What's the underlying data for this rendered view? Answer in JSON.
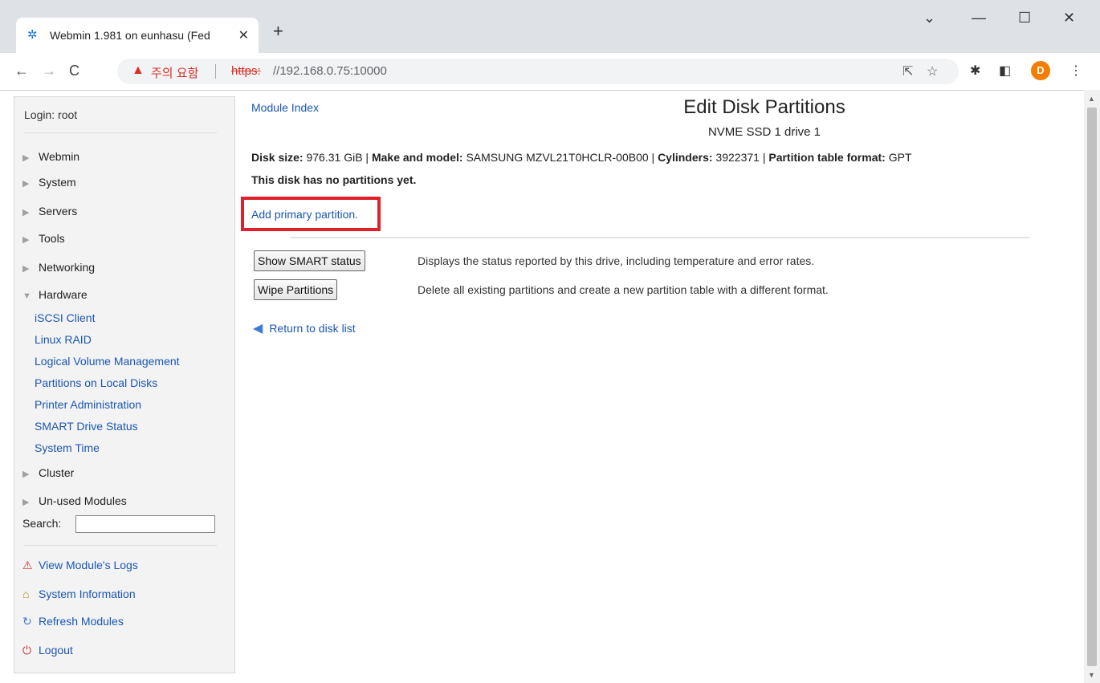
{
  "browser": {
    "tab_title": "Webmin 1.981 on eunhasu (Fed",
    "tab_icon": "webmin-logo-icon",
    "new_tab": "+",
    "warning_text": "주의 요함",
    "url_scheme": "https:",
    "url_rest": "//192.168.0.75:10000",
    "profile_initial": "D"
  },
  "sidebar": {
    "login": "Login: root",
    "categories": [
      {
        "label": "Webmin",
        "expanded": false
      },
      {
        "label": "System",
        "expanded": false
      },
      {
        "label": "Servers",
        "expanded": false
      },
      {
        "label": "Tools",
        "expanded": false
      },
      {
        "label": "Networking",
        "expanded": false
      },
      {
        "label": "Hardware",
        "expanded": true
      }
    ],
    "hardware_items": [
      "iSCSI Client",
      "Linux RAID",
      "Logical Volume Management",
      "Partitions on Local Disks",
      "Printer Administration",
      "SMART Drive Status",
      "System Time"
    ],
    "categories_after": [
      {
        "label": "Cluster"
      },
      {
        "label": "Un-used Modules"
      }
    ],
    "search_label": "Search:",
    "search_value": "",
    "footer_links": [
      {
        "label": "View Module's Logs",
        "icon": "warning-icon"
      },
      {
        "label": "System Information",
        "icon": "home-icon"
      },
      {
        "label": "Refresh Modules",
        "icon": "refresh-icon"
      },
      {
        "label": "Logout",
        "icon": "power-icon"
      }
    ]
  },
  "main": {
    "module_index": "Module Index",
    "title": "Edit Disk Partitions",
    "subtitle": "NVME SSD 1 drive 1",
    "disk_info": {
      "size_label": "Disk size:",
      "size_value": "976.31 GiB",
      "model_label": "Make and model:",
      "model_value": "SAMSUNG MZVL21T0HCLR-00B00",
      "cylinders_label": "Cylinders:",
      "cylinders_value": "3922371",
      "format_label": "Partition table format:",
      "format_value": "GPT",
      "separator": " | "
    },
    "no_partitions": "This disk has no partitions yet.",
    "add_primary": "Add primary partition.",
    "buttons": [
      {
        "label": "Show SMART status",
        "desc": "Displays the status reported by this drive, including temperature and error rates."
      },
      {
        "label": "Wipe Partitions",
        "desc": "Delete all existing partitions and create a new partition table with a different format."
      }
    ],
    "return_link": "Return to disk list"
  },
  "colors": {
    "link": "#1a56b4",
    "highlight_box": "#e0202a",
    "warning": "#d93025"
  }
}
